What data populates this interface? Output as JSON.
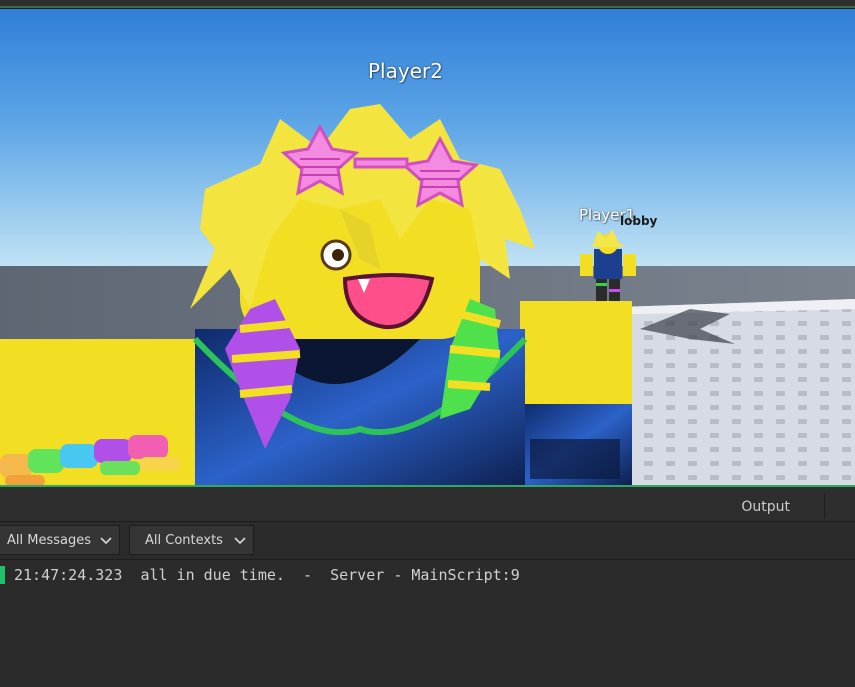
{
  "viewport": {
    "player_labels": [
      {
        "name": "Player2"
      },
      {
        "name": "Player1"
      }
    ],
    "overhead_tag": "lobby"
  },
  "output_panel": {
    "title": "Output",
    "filters": [
      {
        "label": "All Messages"
      },
      {
        "label": "All Contexts"
      }
    ],
    "messages": [
      {
        "timestamp": "21:47:24.323",
        "text": "all in due time.",
        "separator": "-",
        "context": "Server",
        "source": "MainScript:9",
        "status_color": "#1fc16b"
      }
    ]
  },
  "icons": [
    "chevron-down-icon"
  ],
  "colors": {
    "sky_top": "#2f7fd8",
    "sky_horizon": "#bfe2f5",
    "panel_bg": "#2b2b2b",
    "accent_green": "#2fa866"
  }
}
